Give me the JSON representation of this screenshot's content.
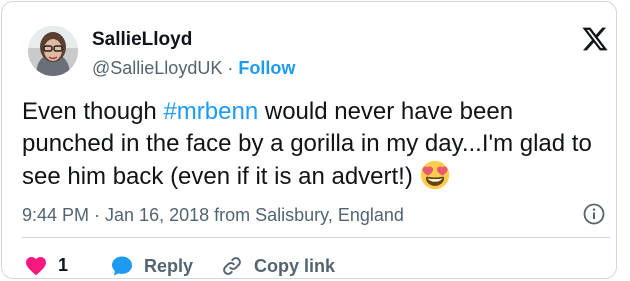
{
  "user": {
    "display_name": "SallieLloyd",
    "handle": "@SallieLloydUK",
    "separator": " · ",
    "follow_label": "Follow"
  },
  "tweet": {
    "text_before": "Even though ",
    "hashtag": "#mrbenn",
    "text_after": " would never have been punched in the face by a gorilla in my day...I'm glad to see him back (even if it is an advert!) ",
    "emoji": "heart-eyes-emoji"
  },
  "meta": {
    "timestamp": "9:44 PM · Jan 16, 2018 from Salisbury, England"
  },
  "actions": {
    "like_count": "1",
    "reply_label": "Reply",
    "copy_link_label": "Copy link"
  },
  "icons": {
    "logo": "x-logo-icon",
    "info": "info-icon",
    "like": "heart-icon",
    "reply": "speech-bubble-icon",
    "copy": "link-icon"
  },
  "colors": {
    "accent": "#1d9bf0",
    "heart": "#f91880",
    "text": "#0f1419",
    "muted": "#536471",
    "border": "#cfd9de"
  }
}
